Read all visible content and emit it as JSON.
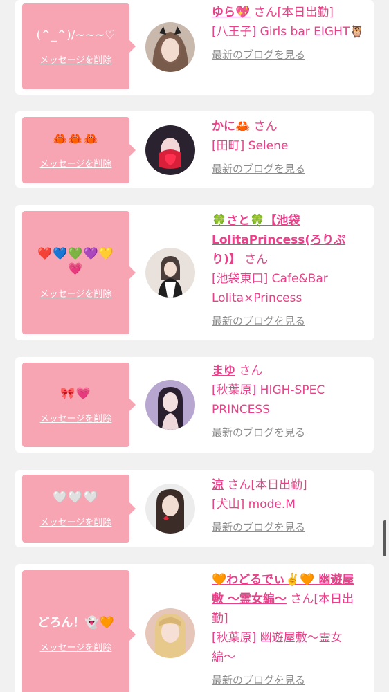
{
  "san_label": "さん",
  "delete_label": "メッセージを削除",
  "blog_label": "最新のブログを見る",
  "cards": [
    {
      "message": "(^_^)/~~~♡",
      "name": "ゆら💖",
      "suffix": "[本日出勤]",
      "shop": "[八王子] Girls bar EIGHT🦉"
    },
    {
      "message": "🦀🦀🦀",
      "name": "かに🦀",
      "suffix": "",
      "shop": "[田町] Selene"
    },
    {
      "message": "❤️💙💚💜💛💗",
      "name": "🍀さと🍀【池袋LolitaPrincess(ろりぷり)】",
      "suffix": "",
      "shop": "[池袋東口] Cafe&Bar Lolita×Princess"
    },
    {
      "message": "🎀💗",
      "name": "まゆ",
      "suffix": "",
      "shop": "[秋葉原] HIGH-SPEC PRINCESS"
    },
    {
      "message": "🤍🤍🤍",
      "name": "涼",
      "suffix": "[本日出勤]",
      "shop": "[犬山] mode.M"
    },
    {
      "message": "どろん！👻🧡",
      "name": "🧡わどるでぃ✌️🧡 幽遊屋敷 〜霊女編〜",
      "suffix": "[本日出勤]",
      "shop": "[秋葉原] 幽遊屋敷〜霊女編〜"
    }
  ]
}
